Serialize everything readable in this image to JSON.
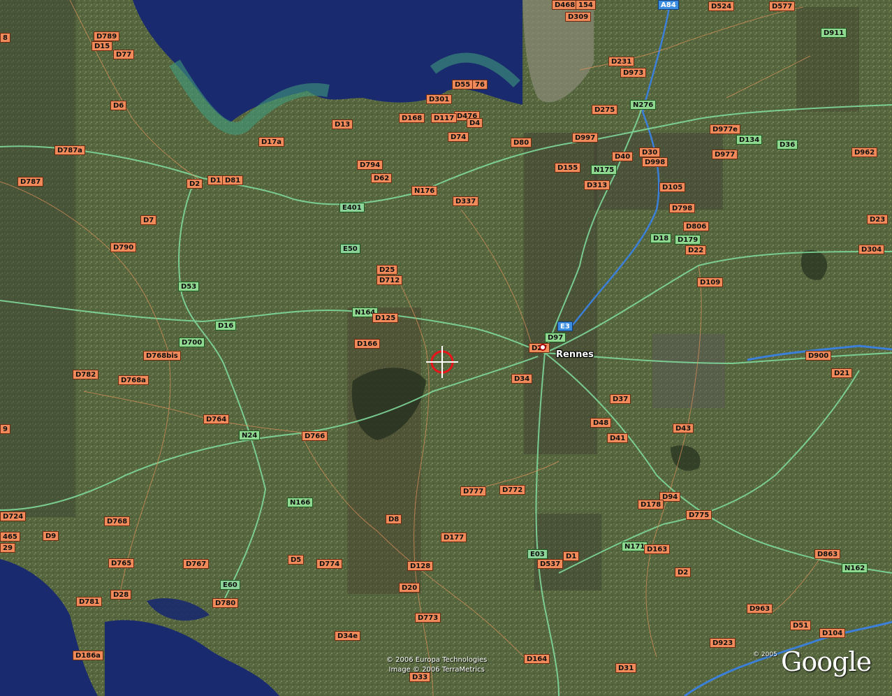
{
  "map": {
    "city": "Rennes",
    "copyright_line1": "© 2006 Europa Technologies",
    "copyright_line2": "Image © 2006 TerraMetrics",
    "logo_copyright": "© 2005",
    "logo": "Google"
  },
  "colors": {
    "departmental_road_shield": "#f08a5a",
    "national_road_shield": "#8fd890",
    "european_route_shield": "#8cd39a",
    "motorway_shield": "#3c8fe0",
    "route_line": "#7fd89a",
    "minor_road_line": "#e0905a",
    "water": "#1a2a6e"
  },
  "road_labels": [
    {
      "text": "D468",
      "type": "d"
    },
    {
      "text": "154",
      "type": "d"
    },
    {
      "text": "A84",
      "type": "b"
    },
    {
      "text": "D524",
      "type": "d"
    },
    {
      "text": "D577",
      "type": "d"
    },
    {
      "text": "D309",
      "type": "d"
    },
    {
      "text": "D911",
      "type": "n"
    },
    {
      "text": "D789",
      "type": "d"
    },
    {
      "text": "D15",
      "type": "d"
    },
    {
      "text": "D77",
      "type": "d"
    },
    {
      "text": "8",
      "type": "d"
    },
    {
      "text": "D231",
      "type": "d"
    },
    {
      "text": "D973",
      "type": "d"
    },
    {
      "text": "D55",
      "type": "d"
    },
    {
      "text": "76",
      "type": "d"
    },
    {
      "text": "D301",
      "type": "d"
    },
    {
      "text": "D6",
      "type": "d"
    },
    {
      "text": "D275",
      "type": "d"
    },
    {
      "text": "N276",
      "type": "n"
    },
    {
      "text": "D476",
      "type": "d"
    },
    {
      "text": "D168",
      "type": "d"
    },
    {
      "text": "D117",
      "type": "d"
    },
    {
      "text": "D4",
      "type": "d"
    },
    {
      "text": "D13",
      "type": "d"
    },
    {
      "text": "D977e",
      "type": "d"
    },
    {
      "text": "D74",
      "type": "d"
    },
    {
      "text": "D997",
      "type": "d"
    },
    {
      "text": "D134",
      "type": "n"
    },
    {
      "text": "D17a",
      "type": "d"
    },
    {
      "text": "D80",
      "type": "d"
    },
    {
      "text": "D36",
      "type": "n"
    },
    {
      "text": "D787a",
      "type": "d"
    },
    {
      "text": "D962",
      "type": "d"
    },
    {
      "text": "D40",
      "type": "d"
    },
    {
      "text": "D30",
      "type": "d"
    },
    {
      "text": "D977",
      "type": "d"
    },
    {
      "text": "D998",
      "type": "d"
    },
    {
      "text": "D794",
      "type": "d"
    },
    {
      "text": "D155",
      "type": "d"
    },
    {
      "text": "N175",
      "type": "n"
    },
    {
      "text": "D62",
      "type": "d"
    },
    {
      "text": "D787",
      "type": "d"
    },
    {
      "text": "D2",
      "type": "d"
    },
    {
      "text": "D1",
      "type": "d"
    },
    {
      "text": "D81",
      "type": "d"
    },
    {
      "text": "D313",
      "type": "d"
    },
    {
      "text": "D105",
      "type": "d"
    },
    {
      "text": "N176",
      "type": "d"
    },
    {
      "text": "D337",
      "type": "d"
    },
    {
      "text": "E401",
      "type": "e"
    },
    {
      "text": "D798",
      "type": "d"
    },
    {
      "text": "D7",
      "type": "d"
    },
    {
      "text": "D23",
      "type": "d"
    },
    {
      "text": "D806",
      "type": "d"
    },
    {
      "text": "D18",
      "type": "n"
    },
    {
      "text": "D179",
      "type": "n"
    },
    {
      "text": "D790",
      "type": "d"
    },
    {
      "text": "E50",
      "type": "e"
    },
    {
      "text": "D22",
      "type": "d"
    },
    {
      "text": "D304",
      "type": "d"
    },
    {
      "text": "D25",
      "type": "d"
    },
    {
      "text": "D712",
      "type": "d"
    },
    {
      "text": "D109",
      "type": "d"
    },
    {
      "text": "D53",
      "type": "n"
    },
    {
      "text": "N164",
      "type": "n"
    },
    {
      "text": "D125",
      "type": "d"
    },
    {
      "text": "D16",
      "type": "n"
    },
    {
      "text": "E3",
      "type": "b"
    },
    {
      "text": "D97",
      "type": "n"
    },
    {
      "text": "D700",
      "type": "n"
    },
    {
      "text": "D166",
      "type": "d"
    },
    {
      "text": "D27",
      "type": "d"
    },
    {
      "text": "D768bis",
      "type": "d"
    },
    {
      "text": "D900",
      "type": "d"
    },
    {
      "text": "D782",
      "type": "d"
    },
    {
      "text": "D21",
      "type": "d"
    },
    {
      "text": "D768a",
      "type": "d"
    },
    {
      "text": "D34",
      "type": "d"
    },
    {
      "text": "D37",
      "type": "d"
    },
    {
      "text": "D764",
      "type": "d"
    },
    {
      "text": "D48",
      "type": "d"
    },
    {
      "text": "9",
      "type": "d"
    },
    {
      "text": "D43",
      "type": "d"
    },
    {
      "text": "N24",
      "type": "n"
    },
    {
      "text": "D766",
      "type": "d"
    },
    {
      "text": "D41",
      "type": "d"
    },
    {
      "text": "D777",
      "type": "d"
    },
    {
      "text": "D772",
      "type": "d"
    },
    {
      "text": "D94",
      "type": "d"
    },
    {
      "text": "N166",
      "type": "n"
    },
    {
      "text": "D178",
      "type": "d"
    },
    {
      "text": "D724",
      "type": "d"
    },
    {
      "text": "D775",
      "type": "d"
    },
    {
      "text": "D768",
      "type": "d"
    },
    {
      "text": "D8",
      "type": "d"
    },
    {
      "text": "465",
      "type": "d"
    },
    {
      "text": "D9",
      "type": "d"
    },
    {
      "text": "D177",
      "type": "d"
    },
    {
      "text": "N171",
      "type": "n"
    },
    {
      "text": "29",
      "type": "d"
    },
    {
      "text": "D163",
      "type": "d"
    },
    {
      "text": "E03",
      "type": "e"
    },
    {
      "text": "D1",
      "type": "d"
    },
    {
      "text": "D863",
      "type": "d"
    },
    {
      "text": "D765",
      "type": "d"
    },
    {
      "text": "D767",
      "type": "d"
    },
    {
      "text": "D5",
      "type": "d"
    },
    {
      "text": "D774",
      "type": "d"
    },
    {
      "text": "D537",
      "type": "d"
    },
    {
      "text": "D128",
      "type": "d"
    },
    {
      "text": "N162",
      "type": "n"
    },
    {
      "text": "D2",
      "type": "d"
    },
    {
      "text": "E60",
      "type": "e"
    },
    {
      "text": "D20",
      "type": "d"
    },
    {
      "text": "D28",
      "type": "d"
    },
    {
      "text": "D781",
      "type": "d"
    },
    {
      "text": "D780",
      "type": "d"
    },
    {
      "text": "D963",
      "type": "d"
    },
    {
      "text": "D773",
      "type": "d"
    },
    {
      "text": "D51",
      "type": "d"
    },
    {
      "text": "D34e",
      "type": "d"
    },
    {
      "text": "D104",
      "type": "d"
    },
    {
      "text": "D923",
      "type": "d"
    },
    {
      "text": "D186a",
      "type": "d"
    },
    {
      "text": "D164",
      "type": "d"
    },
    {
      "text": "D33",
      "type": "d"
    },
    {
      "text": "D31",
      "type": "d"
    }
  ]
}
